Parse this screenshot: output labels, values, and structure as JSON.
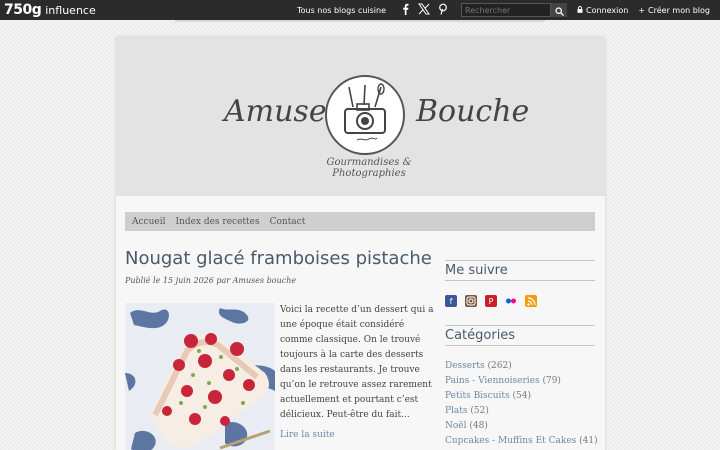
{
  "topbar": {
    "brand_number": "750g",
    "brand_word": "influence",
    "all_blogs": "Tous nos blogs cuisine",
    "search_placeholder": "Rechercher",
    "login": "Connexion",
    "create_blog": "Créer mon blog",
    "icons": [
      "facebook-icon",
      "x-icon",
      "pinterest-icon",
      "search-icon",
      "lock-icon",
      "plus-icon"
    ]
  },
  "header": {
    "title_left": "Amuses",
    "title_right": "Bouche",
    "tagline": "Gourmandises & Photographies"
  },
  "nav": {
    "items": [
      "Accueil",
      "Index des recettes",
      "Contact"
    ]
  },
  "post": {
    "title": "Nougat glacé framboises pistache",
    "meta": "Publié le 15 juin 2026 par Amuses bouche",
    "excerpt": "Voici la recette d’un dessert qui a une époque était considéré comme classique. On le trouvé toujours à la carte des desserts dans les restaurants. Je trouve qu’on le retrouve assez rarement actuellement et pourtant c’est délicieux. Peut-être du fait...",
    "read_more": "Lire la suite"
  },
  "sidebar": {
    "follow_title": "Me suivre",
    "follow_icons": [
      "facebook-icon",
      "instagram-icon",
      "pinterest-icon",
      "flickr-icon",
      "rss-icon"
    ],
    "categories_title": "Catégories",
    "categories": [
      {
        "name": "Desserts",
        "count": "(262)"
      },
      {
        "name": "Pains - Viennoiseries",
        "count": "(79)"
      },
      {
        "name": "Petits Biscuits",
        "count": "(54)"
      },
      {
        "name": "Plats",
        "count": "(52)"
      },
      {
        "name": "Noël",
        "count": "(48)"
      },
      {
        "name": "Cupcakes - Muffins Et Cakes",
        "count": "(41)"
      }
    ]
  },
  "colors": {
    "topbar": "#2b2b2b",
    "link": "#6a88a8",
    "title": "#4a5a6a",
    "facebook": "#3b5998",
    "pinterest": "#cb2027",
    "rss": "#f39c12"
  }
}
